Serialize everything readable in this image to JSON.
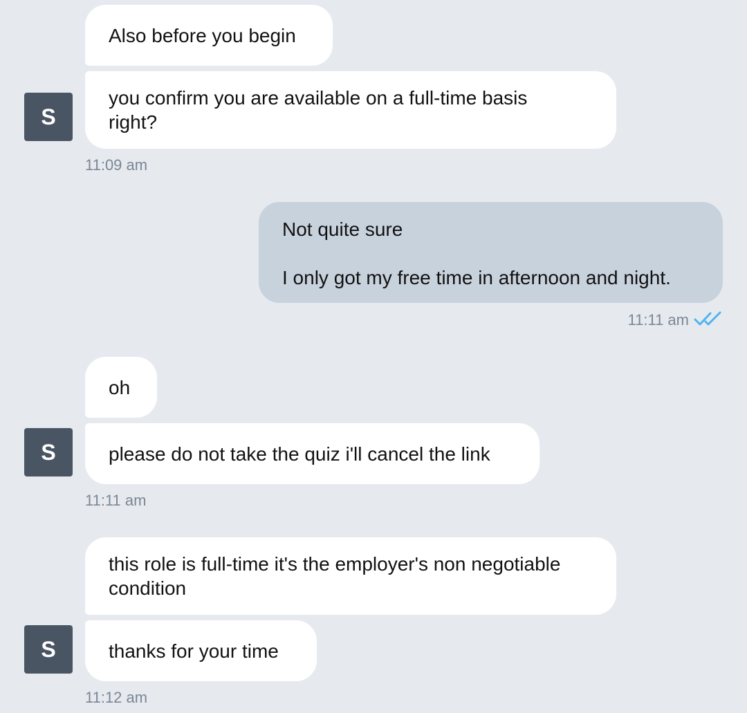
{
  "avatar_letter": "S",
  "colors": {
    "background": "#e6eaef",
    "incoming_bubble": "#ffffff",
    "outgoing_bubble": "#c8d2dd",
    "avatar": "#4a5564",
    "timestamp": "#7b8694",
    "read_ticks": "#4fb3f0"
  },
  "groups": [
    {
      "direction": "incoming",
      "messages": [
        "Also before you begin",
        "you confirm you are available on a full-time basis\nright?"
      ],
      "time": "11:09 am"
    },
    {
      "direction": "outgoing",
      "messages": [
        "Not quite sure\n\nI only got my free time in afternoon and night."
      ],
      "time": "11:11 am",
      "status_icon": "double-check-icon"
    },
    {
      "direction": "incoming",
      "messages": [
        "oh",
        "please do not take the quiz i'll cancel the link"
      ],
      "time": "11:11 am"
    },
    {
      "direction": "incoming",
      "messages": [
        "this role is full-time it's the employer's non negotiable\ncondition",
        "thanks for your time"
      ],
      "time": "11:12 am"
    }
  ]
}
